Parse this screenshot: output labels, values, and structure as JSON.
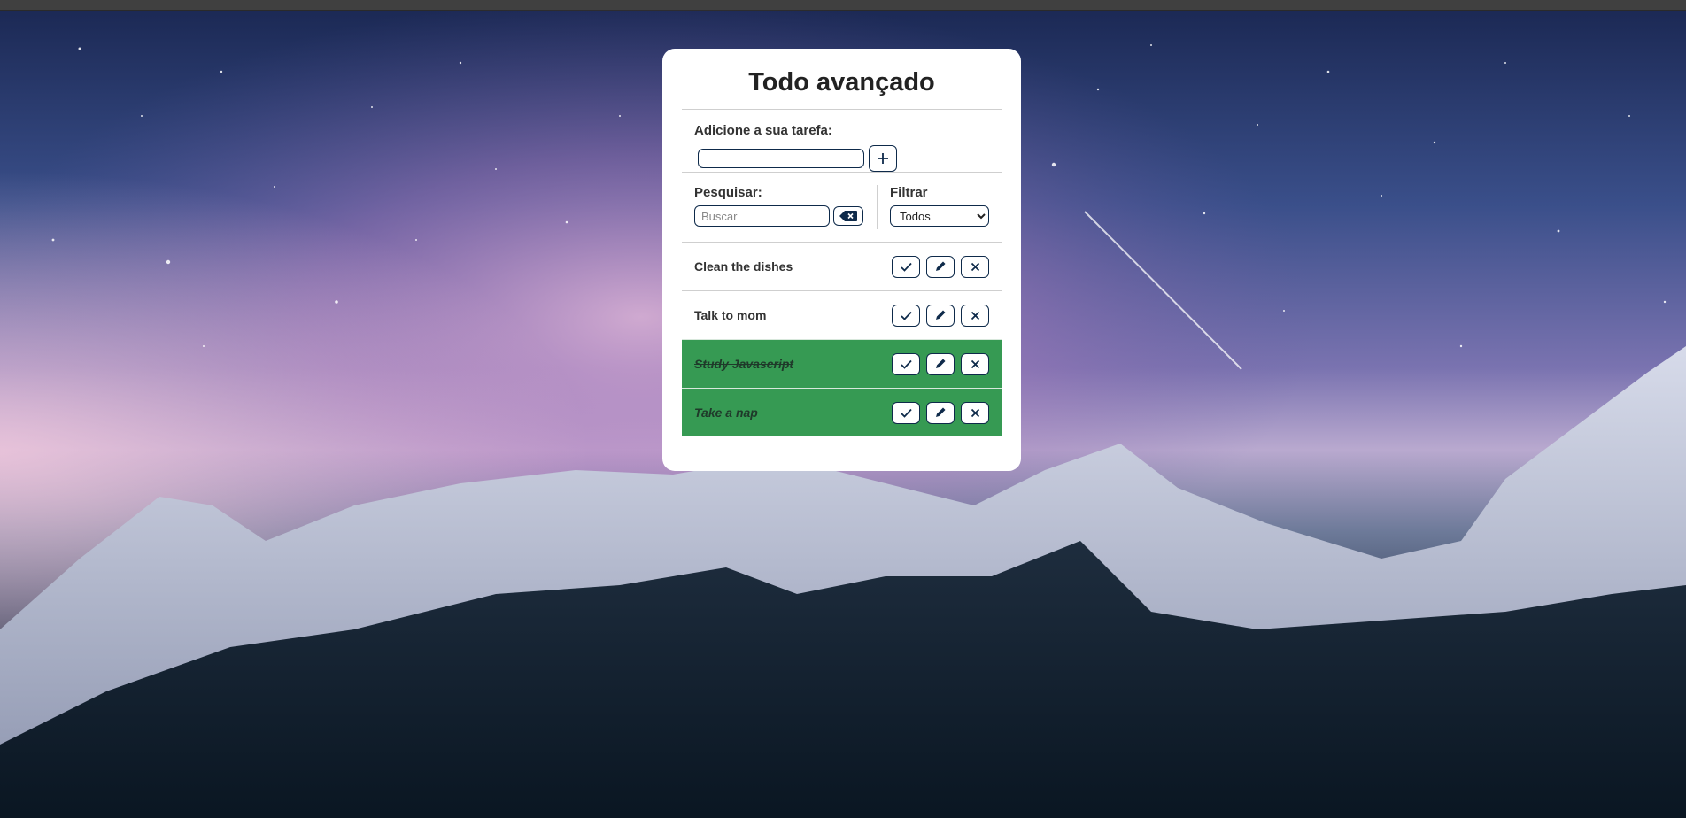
{
  "app": {
    "title": "Todo avançado"
  },
  "add_task": {
    "label": "Adicione a sua tarefa:",
    "input_value": "",
    "add_icon": "plus-icon"
  },
  "search": {
    "label": "Pesquisar:",
    "placeholder": "Buscar",
    "clear_icon": "backspace-icon"
  },
  "filter": {
    "label": "Filtrar",
    "selected": "Todos"
  },
  "todos": [
    {
      "title": "Clean the dishes",
      "done": false
    },
    {
      "title": "Talk to mom",
      "done": false
    },
    {
      "title": "Study Javascript",
      "done": true
    },
    {
      "title": "Take a nap",
      "done": true
    }
  ],
  "item_actions": {
    "check_icon": "check-icon",
    "edit_icon": "pen-icon",
    "remove_icon": "close-icon"
  },
  "colors": {
    "accent": "#0e2a4a",
    "done_background": "#369a53",
    "card_background": "#ffffff"
  }
}
